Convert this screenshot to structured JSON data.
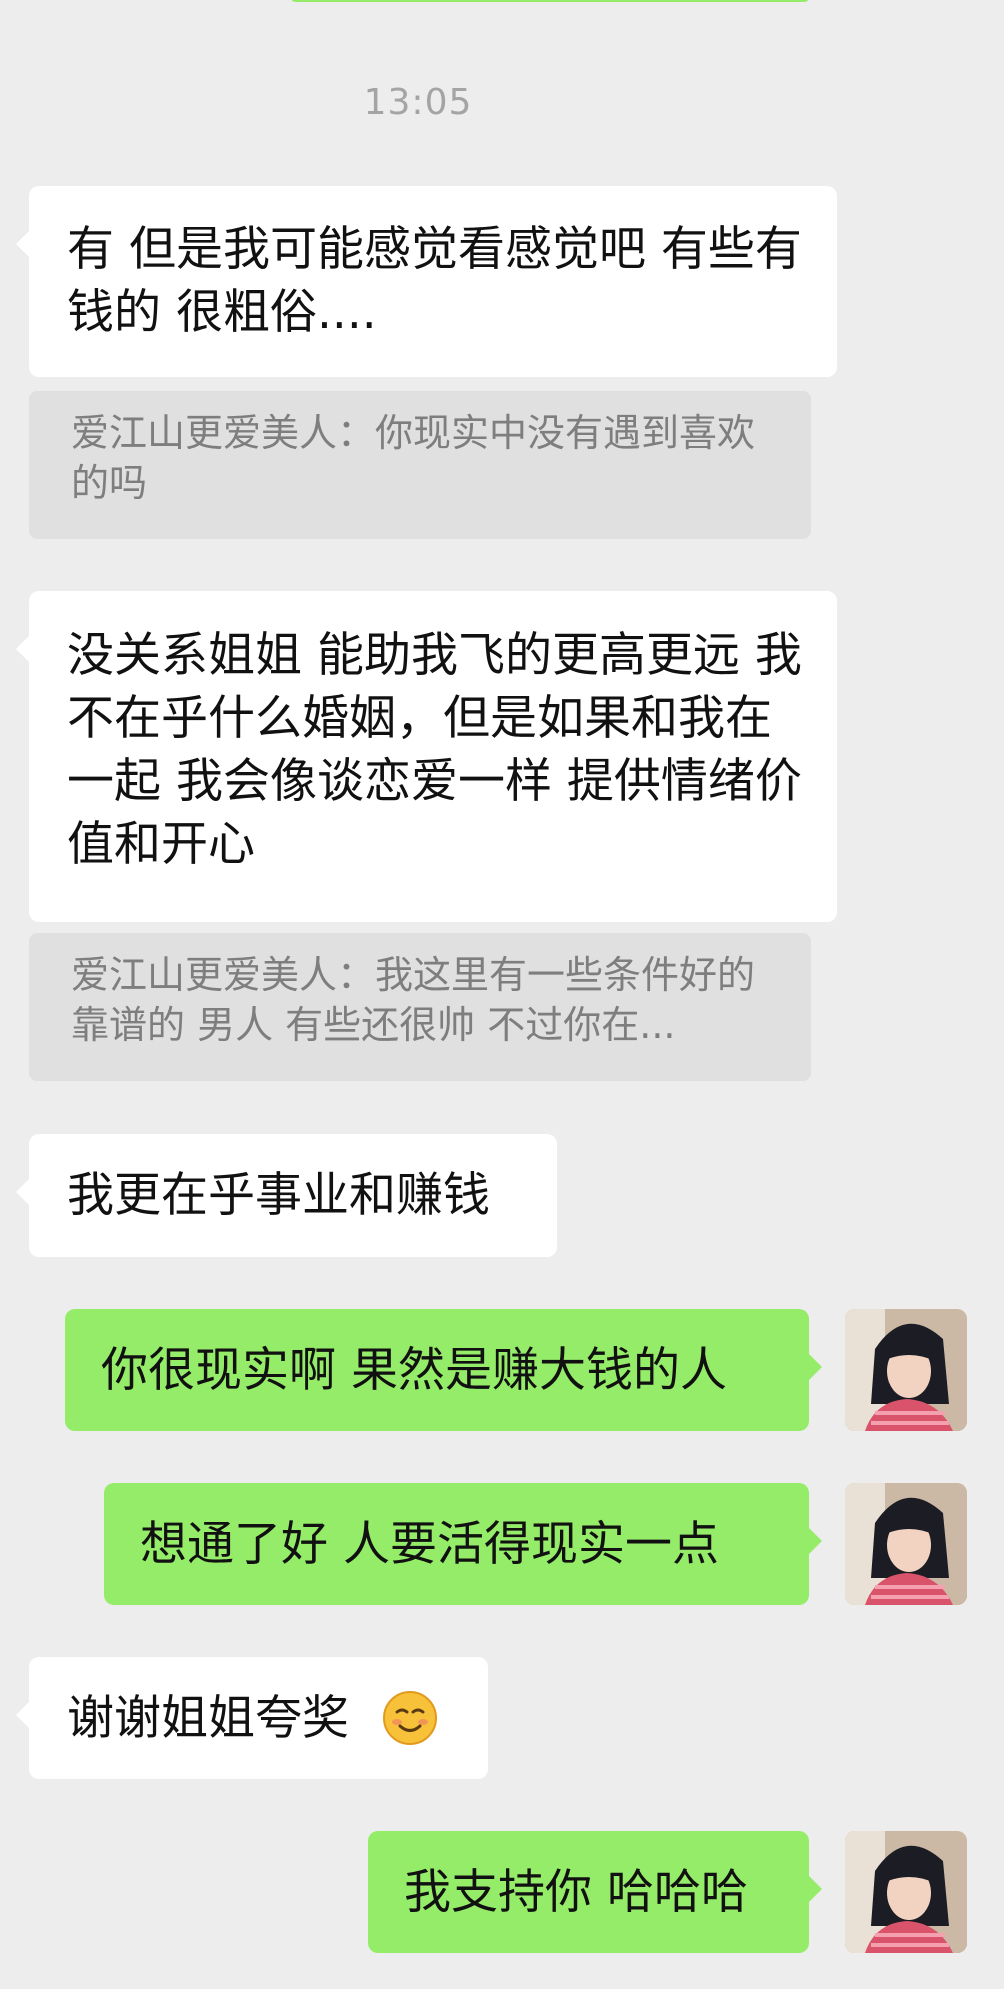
{
  "chat": {
    "timestamp": "13:05",
    "messages": [
      {
        "side": "in",
        "text": "有 但是我可能感觉看感觉吧 有些有钱的 很粗俗...."
      },
      {
        "side": "quote",
        "text": "爱江山更爱美人：你现实中没有遇到喜欢的吗"
      },
      {
        "side": "in",
        "text": "没关系姐姐 能助我飞的更高更远 我不在乎什么婚姻，但是如果和我在一起 我会像谈恋爱一样 提供情绪价值和开心"
      },
      {
        "side": "quote",
        "text": "爱江山更爱美人：我这里有一些条件好的 靠谱的 男人 有些还很帅 不过你在..."
      },
      {
        "side": "in",
        "text": "我更在乎事业和赚钱"
      },
      {
        "side": "out",
        "text": "你很现实啊 果然是赚大钱的人"
      },
      {
        "side": "out",
        "text": "想通了好 人要活得现实一点"
      },
      {
        "side": "in",
        "text": "谢谢姐姐夸奖",
        "emoji": "smiling-face-emoji"
      },
      {
        "side": "out",
        "text": "我支持你 哈哈哈"
      }
    ]
  },
  "colors": {
    "background": "#ededed",
    "incoming_bubble": "#ffffff",
    "outgoing_bubble": "#95ec69",
    "quote_bubble": "#e0e0e0",
    "timestamp_text": "#a4a4a4",
    "quote_text": "#7e7e7e"
  }
}
